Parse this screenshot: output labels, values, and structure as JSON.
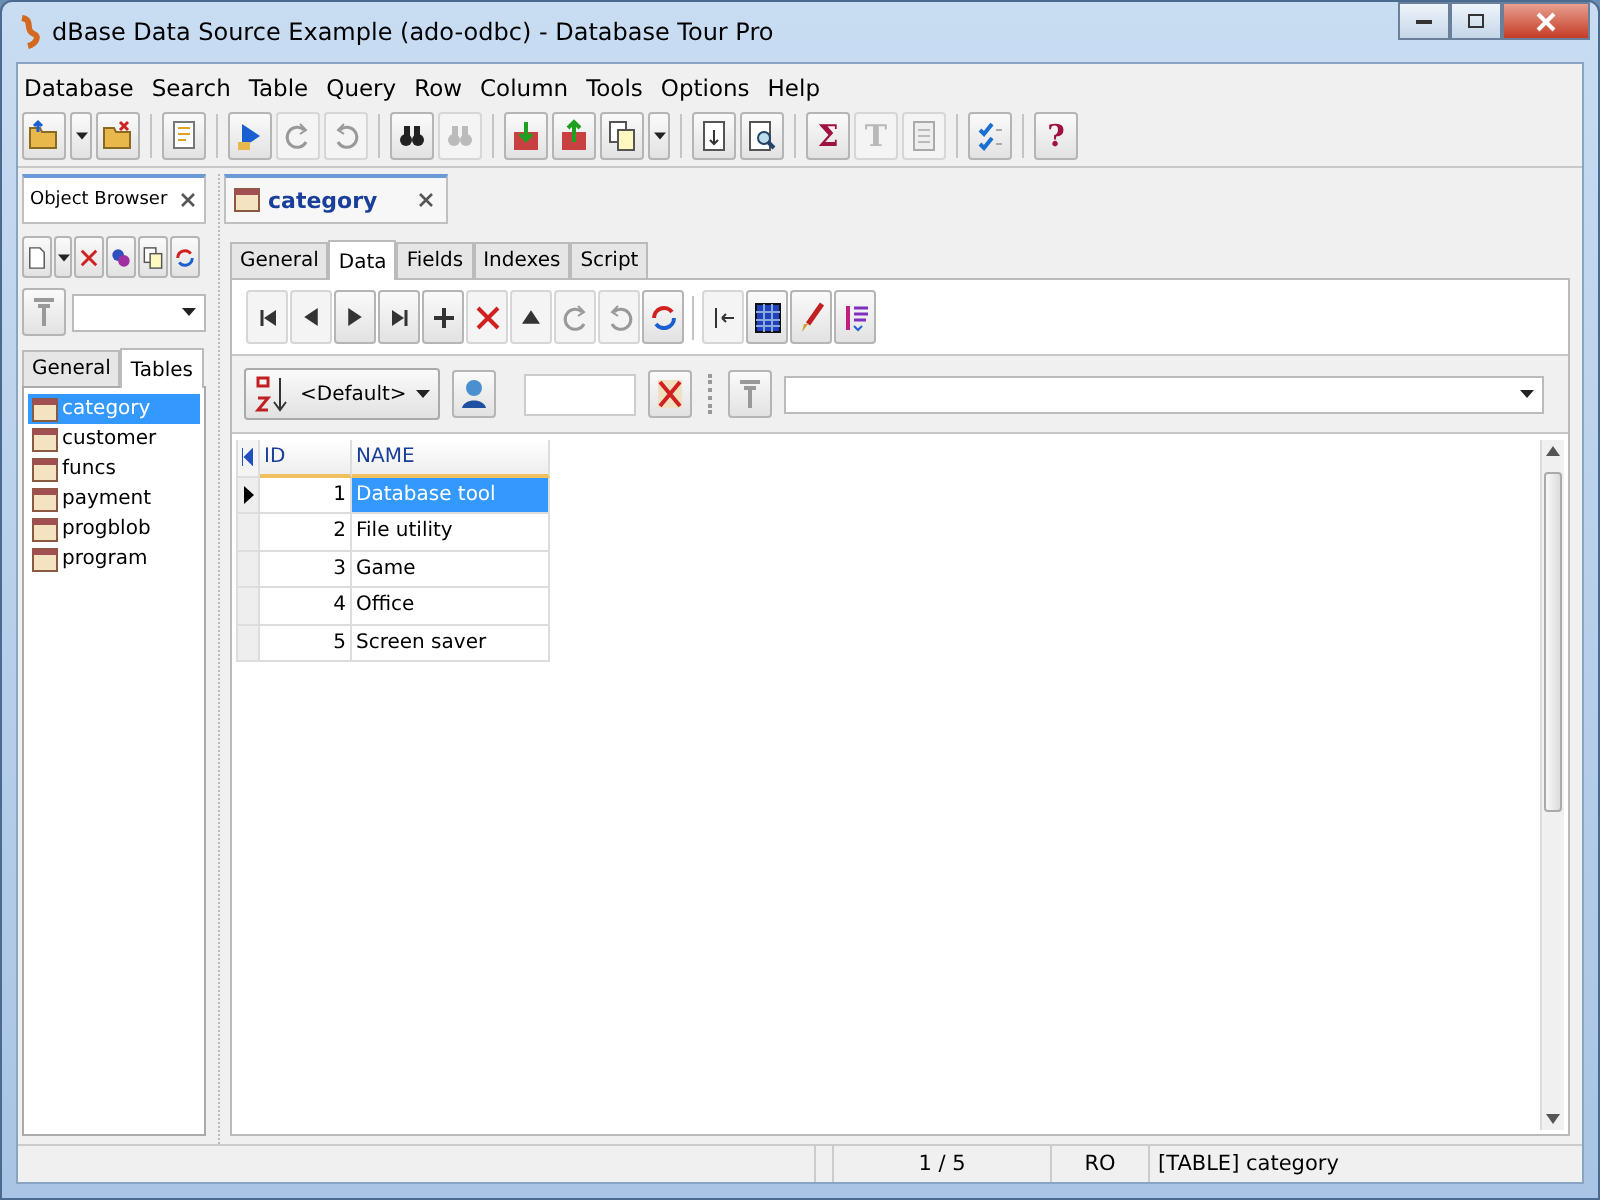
{
  "window": {
    "title": "dBase Data Source Example (ado-odbc) - Database Tour Pro"
  },
  "menu": [
    "Database",
    "Search",
    "Table",
    "Query",
    "Row",
    "Column",
    "Tools",
    "Options",
    "Help"
  ],
  "toolbar": [
    {
      "kind": "open",
      "disabled": false
    },
    {
      "kind": "dropdown",
      "disabled": false
    },
    {
      "kind": "close",
      "disabled": false
    },
    {
      "kind": "sep"
    },
    {
      "kind": "script",
      "disabled": false
    },
    {
      "kind": "sep"
    },
    {
      "kind": "run",
      "disabled": false
    },
    {
      "kind": "redo",
      "disabled": true
    },
    {
      "kind": "undo",
      "disabled": true
    },
    {
      "kind": "sep"
    },
    {
      "kind": "find",
      "disabled": false
    },
    {
      "kind": "findnext",
      "disabled": true
    },
    {
      "kind": "sep"
    },
    {
      "kind": "import",
      "disabled": false
    },
    {
      "kind": "export",
      "disabled": false
    },
    {
      "kind": "copy",
      "disabled": false
    },
    {
      "kind": "dropdown",
      "disabled": false
    },
    {
      "kind": "sep"
    },
    {
      "kind": "page",
      "disabled": false
    },
    {
      "kind": "preview",
      "disabled": false
    },
    {
      "kind": "sep"
    },
    {
      "kind": "glyph",
      "label": "Σ",
      "disabled": false
    },
    {
      "kind": "glyph",
      "label": "T",
      "disabled": true
    },
    {
      "kind": "notes",
      "disabled": true
    },
    {
      "kind": "sep"
    },
    {
      "kind": "check",
      "disabled": false
    },
    {
      "kind": "sep"
    },
    {
      "kind": "glyph",
      "label": "?",
      "disabled": false
    }
  ],
  "left_panel": {
    "title": "Object Browser",
    "toolbar": [
      {
        "kind": "new",
        "disabled": false
      },
      {
        "kind": "dropdown",
        "disabled": false
      },
      {
        "kind": "delete",
        "disabled": false
      },
      {
        "kind": "cubes",
        "disabled": false
      },
      {
        "kind": "copy",
        "disabled": false
      },
      {
        "kind": "refresh",
        "disabled": false
      }
    ],
    "tabs": [
      {
        "label": "General",
        "selected": false
      },
      {
        "label": "Tables",
        "selected": true
      }
    ],
    "items": [
      {
        "label": "category",
        "selected": true
      },
      {
        "label": "customer",
        "selected": false
      },
      {
        "label": "funcs",
        "selected": false
      },
      {
        "label": "payment",
        "selected": false
      },
      {
        "label": "progblob",
        "selected": false
      },
      {
        "label": "program",
        "selected": false
      }
    ]
  },
  "document_tab": {
    "title": "category"
  },
  "tabs": [
    {
      "label": "General",
      "selected": false
    },
    {
      "label": "Data",
      "selected": true
    },
    {
      "label": "Fields",
      "selected": false
    },
    {
      "label": "Indexes",
      "selected": false
    },
    {
      "label": "Script",
      "selected": false
    }
  ],
  "nav_toolbar": [
    {
      "kind": "first",
      "disabled": true
    },
    {
      "kind": "prev",
      "disabled": true
    },
    {
      "kind": "next",
      "disabled": false
    },
    {
      "kind": "last",
      "disabled": false
    },
    {
      "kind": "add",
      "disabled": false
    },
    {
      "kind": "delete",
      "disabled": true
    },
    {
      "kind": "post",
      "disabled": true
    },
    {
      "kind": "redo",
      "disabled": true
    },
    {
      "kind": "undo",
      "disabled": true
    },
    {
      "kind": "refresh",
      "disabled": false
    },
    {
      "kind": "sep"
    },
    {
      "kind": "colfirst",
      "disabled": true
    },
    {
      "kind": "grid",
      "disabled": false
    },
    {
      "kind": "brush",
      "disabled": false
    },
    {
      "kind": "format",
      "disabled": false
    }
  ],
  "sort": {
    "value": "<Default>"
  },
  "grid": {
    "columns": [
      "ID",
      "NAME"
    ],
    "rows": [
      {
        "cells": [
          "1",
          "Database tool"
        ],
        "current": true,
        "selected": true
      },
      {
        "cells": [
          "2",
          "File utility"
        ],
        "current": false,
        "selected": false
      },
      {
        "cells": [
          "3",
          "Game"
        ],
        "current": false,
        "selected": false
      },
      {
        "cells": [
          "4",
          "Office"
        ],
        "current": false,
        "selected": false
      },
      {
        "cells": [
          "5",
          "Screen saver"
        ],
        "current": false,
        "selected": false
      }
    ]
  },
  "status_bar": {
    "position": "1 / 5",
    "mode": "RO",
    "object": "[TABLE] category"
  }
}
